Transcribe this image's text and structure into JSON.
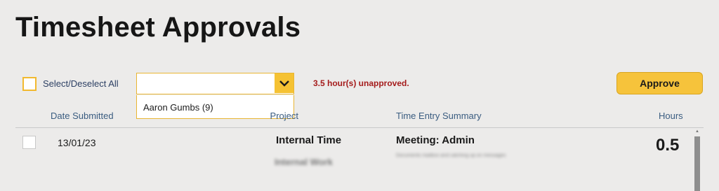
{
  "page": {
    "title": "Timesheet Approvals"
  },
  "toolbar": {
    "select_all_label": "Select/Deselect All",
    "dropdown": {
      "value": "",
      "options": [
        "Aaron Gumbs (9)"
      ]
    },
    "unapproved_text": "3.5 hour(s) unapproved.",
    "approve_label": "Approve"
  },
  "table": {
    "headers": {
      "date_submitted": "Date Submitted",
      "project": "Project",
      "summary": "Time Entry Summary",
      "hours": "Hours"
    },
    "rows": [
      {
        "date": "13/01/23",
        "project": "Internal Time",
        "project_sub": "Internal Work",
        "summary": "Meeting: Admin",
        "summary_sub": "Documents mailbox and catching up on messages",
        "hours": "0.5"
      }
    ]
  },
  "colors": {
    "accent": "#f6c33b",
    "warning": "#a51c1c",
    "header_text": "#3a5c80"
  }
}
